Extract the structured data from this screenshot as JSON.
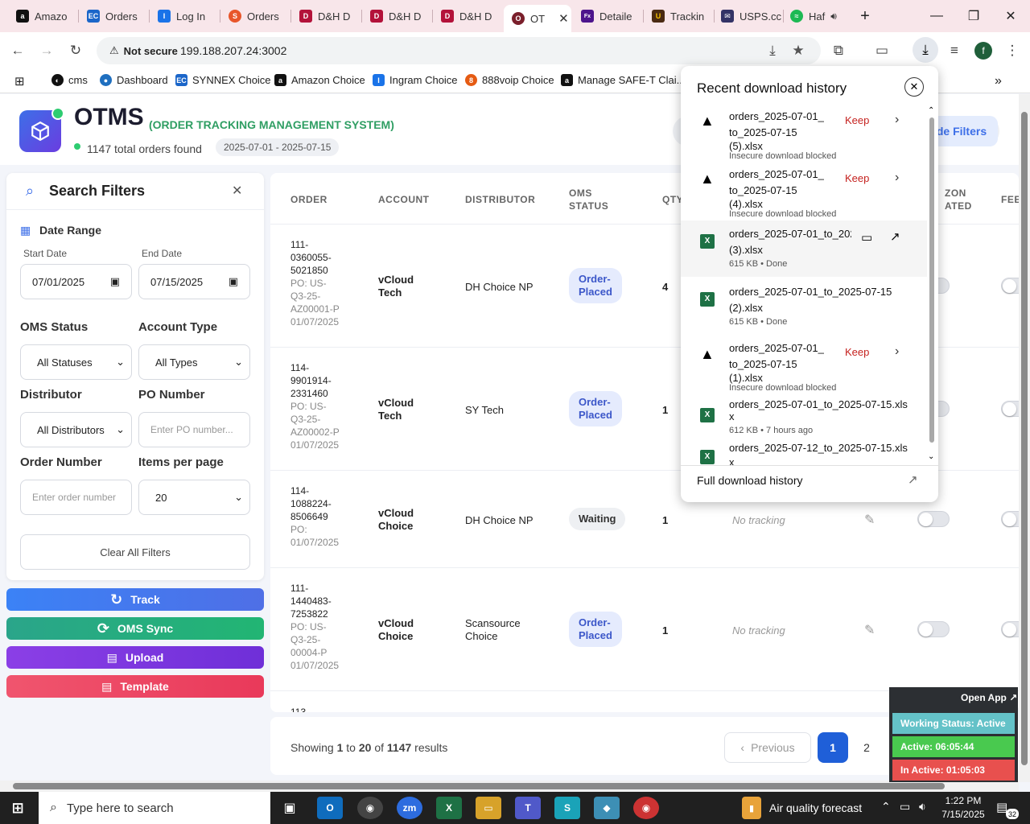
{
  "browser": {
    "tabs": [
      {
        "label": "Amazo",
        "icon": "amazon-icon"
      },
      {
        "label": "Orders",
        "icon": "ec-icon"
      },
      {
        "label": "Log In",
        "icon": "ingram-icon"
      },
      {
        "label": "Orders",
        "icon": "orders-icon"
      },
      {
        "label": "D&H D",
        "icon": "dh-icon"
      },
      {
        "label": "D&H D",
        "icon": "dh-icon"
      },
      {
        "label": "D&H D",
        "icon": "dh-icon"
      },
      {
        "label": "OT",
        "icon": "otms-icon"
      },
      {
        "label": "Detaile",
        "icon": "fedex-icon"
      },
      {
        "label": "Trackin",
        "icon": "ups-icon"
      },
      {
        "label": "USPS.cc",
        "icon": "usps-icon"
      },
      {
        "label": "Haf",
        "icon": "spotify-icon"
      }
    ],
    "security_label": "Not secure",
    "url": "199.188.207.24:3002",
    "profile_initial": "f",
    "bookmarks": [
      {
        "label": "cms",
        "icon": "cms-icon"
      },
      {
        "label": "Dashboard",
        "icon": "dashboard-icon"
      },
      {
        "label": "SYNNEX Choice",
        "icon": "ec-icon"
      },
      {
        "label": "Amazon Choice",
        "icon": "amazon-icon"
      },
      {
        "label": "Ingram Choice",
        "icon": "ingram-icon"
      },
      {
        "label": "888voip Choice",
        "icon": "voip-icon"
      },
      {
        "label": "Manage SAFE-T Clai...",
        "icon": "amazon-icon"
      }
    ]
  },
  "app": {
    "title": "OTMS",
    "subtitle": "(ORDER TRACKING MANAGEMENT SYSTEM)",
    "total_text": "1147 total orders found",
    "date_range": "2025-07-01 - 2025-07-15",
    "hide_filters_label": "de Filters"
  },
  "filters": {
    "title": "Search Filters",
    "date_range_label": "Date Range",
    "start_label": "Start Date",
    "start_value": "07/01/2025",
    "end_label": "End Date",
    "end_value": "07/15/2025",
    "oms_status_label": "OMS Status",
    "oms_status_value": "All Statuses",
    "account_type_label": "Account Type",
    "account_type_value": "All Types",
    "distributor_label": "Distributor",
    "distributor_value": "All Distributors",
    "po_label": "PO Number",
    "po_placeholder": "Enter PO number...",
    "order_label": "Order Number",
    "order_placeholder": "Enter order number",
    "per_page_label": "Items per page",
    "per_page_value": "20",
    "clear_label": "Clear All Filters"
  },
  "actions": {
    "track": "Track",
    "oms_sync": "OMS Sync",
    "upload": "Upload",
    "template": "Template"
  },
  "table": {
    "headers": [
      "ORDER",
      "ACCOUNT",
      "DISTRIBUTOR",
      "OMS STATUS",
      "QTY",
      "ZON ATED",
      "FEE"
    ],
    "header_oms_1": "OMS",
    "header_oms_2": "STATUS",
    "header_zon_1": "ZON",
    "header_zon_2": "ATED",
    "rows": [
      {
        "order_lines": [
          "111-",
          "0360055-",
          "5021850"
        ],
        "po_lines": [
          "PO: US-",
          "Q3-25-",
          "AZ00001-P"
        ],
        "date": "01/07/2025",
        "account_lines": [
          "vCloud",
          "Tech"
        ],
        "distributor": "DH Choice NP",
        "status_lines": [
          "Order-",
          "Placed"
        ],
        "qty": "4",
        "tracking": ""
      },
      {
        "order_lines": [
          "114-",
          "9901914-",
          "2331460"
        ],
        "po_lines": [
          "PO: US-",
          "Q3-25-",
          "AZ00002-P"
        ],
        "date": "01/07/2025",
        "account_lines": [
          "vCloud",
          "Tech"
        ],
        "distributor": "SY Tech",
        "status_lines": [
          "Order-",
          "Placed"
        ],
        "qty": "1",
        "tracking": ""
      },
      {
        "order_lines": [
          "114-",
          "1088224-",
          "8506649"
        ],
        "po_lines": [
          "PO:"
        ],
        "date": "01/07/2025",
        "account_lines": [
          "vCloud",
          "Choice"
        ],
        "distributor": "DH Choice NP",
        "status_lines": [
          "Waiting"
        ],
        "qty": "1",
        "tracking": "No tracking"
      },
      {
        "order_lines": [
          "111-",
          "1440483-",
          "7253822"
        ],
        "po_lines": [
          "PO: US-",
          "Q3-25-",
          "00004-P"
        ],
        "date": "01/07/2025",
        "account_lines": [
          "vCloud",
          "Choice"
        ],
        "distributor_lines": [
          "Scansource",
          "Choice"
        ],
        "status_lines": [
          "Order-",
          "Placed"
        ],
        "qty": "1",
        "tracking": "No tracking"
      }
    ],
    "partial_row": "113"
  },
  "pagination": {
    "showing": "Showing",
    "from": "1",
    "to_word": "to",
    "to": "20",
    "of_word": "of",
    "total": "1147",
    "results_word": "results",
    "previous": "Previous",
    "page1": "1",
    "page2": "2"
  },
  "downloads": {
    "title": "Recent download history",
    "items": [
      {
        "name_lines": [
          "orders_2025-07-01_",
          "to_2025-07-15",
          "(5).xlsx"
        ],
        "status": "Insecure download blocked",
        "keep": "Keep",
        "kind": "blocked"
      },
      {
        "name_lines": [
          "orders_2025-07-01_",
          "to_2025-07-15",
          "(4).xlsx"
        ],
        "status": "Insecure download blocked",
        "keep": "Keep",
        "kind": "blocked"
      },
      {
        "name_lines": [
          "orders_2025-07-01_to_202",
          "(3).xlsx"
        ],
        "status": "615 KB • Done",
        "kind": "done"
      },
      {
        "name_lines": [
          "orders_2025-07-01_to_2025-07-15",
          "(2).xlsx"
        ],
        "status": "615 KB • Done",
        "kind": "done"
      },
      {
        "name_lines": [
          "orders_2025-07-01_",
          "to_2025-07-15",
          "(1).xlsx"
        ],
        "status": "Insecure download blocked",
        "keep": "Keep",
        "kind": "blocked"
      },
      {
        "name_lines": [
          "orders_2025-07-01_to_2025-07-15.xls",
          "x"
        ],
        "status": "612 KB • 7 hours ago",
        "kind": "done"
      },
      {
        "name_lines": [
          "orders_2025-07-12_to_2025-07-15.xls",
          "x"
        ],
        "status": "",
        "kind": "done"
      }
    ],
    "full_history": "Full download history"
  },
  "widget": {
    "open_app": "Open App ↗",
    "working_status": "Working Status: Active",
    "active": "Active: 06:05:44",
    "inactive": "In Active: 01:05:03"
  },
  "taskbar": {
    "search_placeholder": "Type here to search",
    "weather": "Air quality forecast",
    "time": "1:22 PM",
    "date": "7/15/2025",
    "notif_count": "32"
  },
  "colors": {
    "brand": "#3d6fe8",
    "green": "#2f9e63",
    "track": "#3b82f6",
    "sync": "#2aa58a",
    "upload": "#7c3aed",
    "template": "#ef4861",
    "blocked": "#c5221f"
  }
}
